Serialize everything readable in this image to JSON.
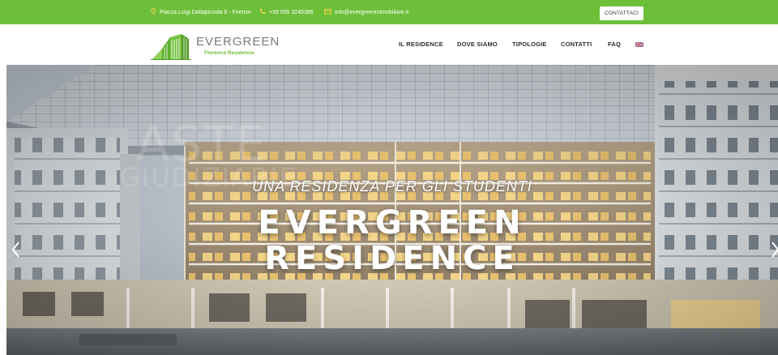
{
  "topbar": {
    "address": "Piazza Luigi Dallapiccola 6 - Firenze",
    "phone": "+39 055 3245386",
    "email": "info@evergreenimmobiliare.it",
    "cta_label": "CONTATTACI",
    "background": "#6dbf3a",
    "icon_color": "#f5d84a",
    "icons": [
      "map-pin-icon",
      "phone-icon",
      "mail-icon"
    ]
  },
  "logo": {
    "name": "EVERGREEN",
    "subtitle": "Florence Residence",
    "accent": "#6dbf3a"
  },
  "nav": {
    "items": [
      {
        "label": "IL RESIDENCE"
      },
      {
        "label": "DOVE SIAMO"
      },
      {
        "label": "TIPOLOGIE"
      },
      {
        "label": "CONTATTI"
      },
      {
        "label": "FAQ"
      }
    ],
    "language_icon": "uk-flag-icon"
  },
  "hero": {
    "subtitle": "UNA RESIDENZA PER GLI STUDENTI",
    "title_line1": "EVERGREEN",
    "title_line2": "RESIDENCE",
    "watermark": "ASTE GIUDIZIARIE",
    "prev_icon": "chevron-left-icon",
    "next_icon": "chevron-right-icon"
  }
}
